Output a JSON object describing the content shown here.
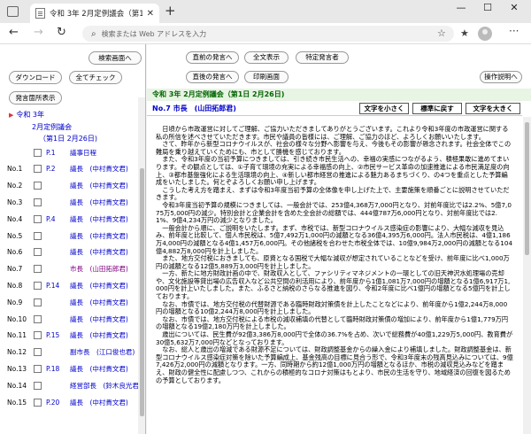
{
  "browser": {
    "tab_title": "令和 3年 2月定例議会（第1日 2月26日)",
    "new_tab": "+",
    "address_placeholder": "検索または Web アドレスを入力",
    "win_min": "—",
    "win_max": "☐",
    "win_close": "✕",
    "tab_close": "✕"
  },
  "left": {
    "search_screen": "検索画面へ",
    "download": "ダウンロード",
    "check_all": "全てチェック",
    "speaker_display": "発言箇所表示",
    "tree_root": "令和 3年",
    "tree_session": "2月定例議会",
    "tree_day": "（第1日 2月26日)",
    "items": [
      {
        "no": "",
        "page": "P.1",
        "name": "議事日程",
        "selected": false
      },
      {
        "no": "No.1",
        "page": "P.2",
        "name": "議長　(中村貴文君)",
        "selected": false
      },
      {
        "no": "No.2",
        "page": "",
        "name": "議長　(中村貴文君)",
        "selected": false
      },
      {
        "no": "No.3",
        "page": "",
        "name": "議長　(中村貴文君)",
        "selected": false
      },
      {
        "no": "No.4",
        "page": "P.4",
        "name": "議長　(中村貴文君)",
        "selected": false
      },
      {
        "no": "No.5",
        "page": "",
        "name": "議長　(中村貴文君)",
        "selected": false
      },
      {
        "no": "No.6",
        "page": "",
        "name": "議長　(中村貴文君)",
        "selected": false
      },
      {
        "no": "No.7",
        "page": "",
        "name": "市長　(山田拓郎君)",
        "selected": true
      },
      {
        "no": "No.8",
        "page": "P.14",
        "name": "議長　(中村貴文君)",
        "selected": false
      },
      {
        "no": "No.9",
        "page": "",
        "name": "議長　(中村貴文君)",
        "selected": false
      },
      {
        "no": "No.10",
        "page": "",
        "name": "議長　(中村貴文君)",
        "selected": false
      },
      {
        "no": "No.11",
        "page": "P.15",
        "name": "議長　(中村貴文君)",
        "selected": false
      },
      {
        "no": "No.12",
        "page": "",
        "name": "副市長　(江口俊也君)",
        "selected": false
      },
      {
        "no": "No.13",
        "page": "P.18",
        "name": "議長　(中村貴文君)",
        "selected": false
      },
      {
        "no": "No.14",
        "page": "",
        "name": "経営部長　(鈴木良光君)",
        "selected": false
      },
      {
        "no": "No.15",
        "page": "P.20",
        "name": "議長　(中村貴文君)",
        "selected": false
      }
    ]
  },
  "right": {
    "prev_speaker": "直前の発言へ",
    "show_all": "全文表示",
    "specific_speaker": "特定発言者",
    "next_speaker": "直後の発言へ",
    "print_screen": "印刷画面",
    "help": "操作説明へ",
    "session_header": "令和 3年 2月定例議会（第1日 2月26日)",
    "speaker_header": "No.7 市長　(山田拓郎君)",
    "text_smaller": "文字を小さく",
    "text_standard": "標準に戻す",
    "text_larger": "文字を大きく",
    "body": "　日頃から市政運営に対してご理解、ご協力いただきましてありがとうございます。これより令和3年度の市政運営に関する私の所信を述べさせていただきます。市民や議員の皆様には、ご理解、ご協力のほど、よろしくお願いいたします。\n　さて、昨年から新型コロナウイルスが、社会の様々な分野へ影響を与え、今後もその影響が懸念されます。社会全体でこの難局を乗り越えていくためにも、市として勝機を感じております。\n　また、令和3年度の当初予算につきましては、引き続き市民生活への、幸福の実感につながるよう、積極果敢に進めてまいります。その観点としては、①子育て環境の充実による幸福感の向上、②市民サービス革命の加速推進による市民満足度の向上、③都市基盤強化による生活環境の向上、④新しい都市経営の推進による魅力あるまちづくり、の4つを重点とした予算編成をいたしました。何とぞよろしくお願い申し上げます。\n　こうした考え方を踏まえ、まずは令和3年度当初予算の全体像を申し上げた上で、主要施策を順番ごとに説明させていただきます。\n　令和3年度当初予算の規模につきましては、一般会計では、253億4,368万7,000円となり、対前年度比では2.2%、5億7,075万5,000円の減少。特別会計と企業会計を含めた全会計の総額では、444億787万6,000円となり、対前年度比では2.1%、9億4,234万円の減少となりました。\n　一般会計から順に、ご説明をいたします。まず、市税では、新型コロナウイルス感染症の影響により、大幅な減収を見込み、前年度と比較して、個人市民税は、5億7,492万1,000円の減額となる36億4,395万6,000円。法人市民税は、4億1,186万4,000円の減額となる4億1,457万6,000円。その他諸税を合わせた市税全体では、10億9,984万2,000円の減額となる104億4,882万8,000円を計上しました。\n　また、地方交付税におきましても、原資となる国税で大幅な減収が想定されていることなどを受け、前年度に比べ1,000万円の減額となる12億5,889万3,000円を計上しました。\n　一方、新たに地方財政計画の中で、財政収入として、ファシリティマネジメントの一環としての旧天神沢水処理場の売却や、文化施設等貸出場の広告収入など公共空間の利活用により、前年度から1億1,081万7,000円の増額となる1億6,917万1,000円を計上いたしました。また、ふるさと納税のさらなる推進を図り、令和2年度に比べ1億円の増額となる5億円を計上しております。\n　なお、市債では、地方交付税の代替財源である臨時財政対策債を計上したことなどにより、前年度から1億2,244万8,000円の増額となる10億2,244万8,000円を計上しました。\n　なお、市債では、地方交付税による市税の減収補填の代替として臨時財政対策債の増加により、前年度から1億1,779万円の増額となる19億2,180万円を計上しました。\n　歳出については、民生費が92億3,386万8,000円で全体の36.7%を占め、次いで総務費が40億1,229万5,000円、教育費が30億5,632万7,000円などとなっております。\n　なお、総人と歳出の増減である財源不足については、財政調整基金からの繰入金により補填しました。財政調整基金は、新型コロナウイルス感染症対策を除いた予算編成上、基金残高の目標に見合う形で、令和3年度末の残高見込みについては、9億7,426万2,000円の減額となります。一方、同時期から約12億1,000万円の増額となるほか、市税の減収見込みなどを踏まえ、財政の健全性に配慮しつつ、これからの積極的なコロナ対策はもとより、市民の生活を守り、地域経済の回復を図るための予算としております。"
  }
}
